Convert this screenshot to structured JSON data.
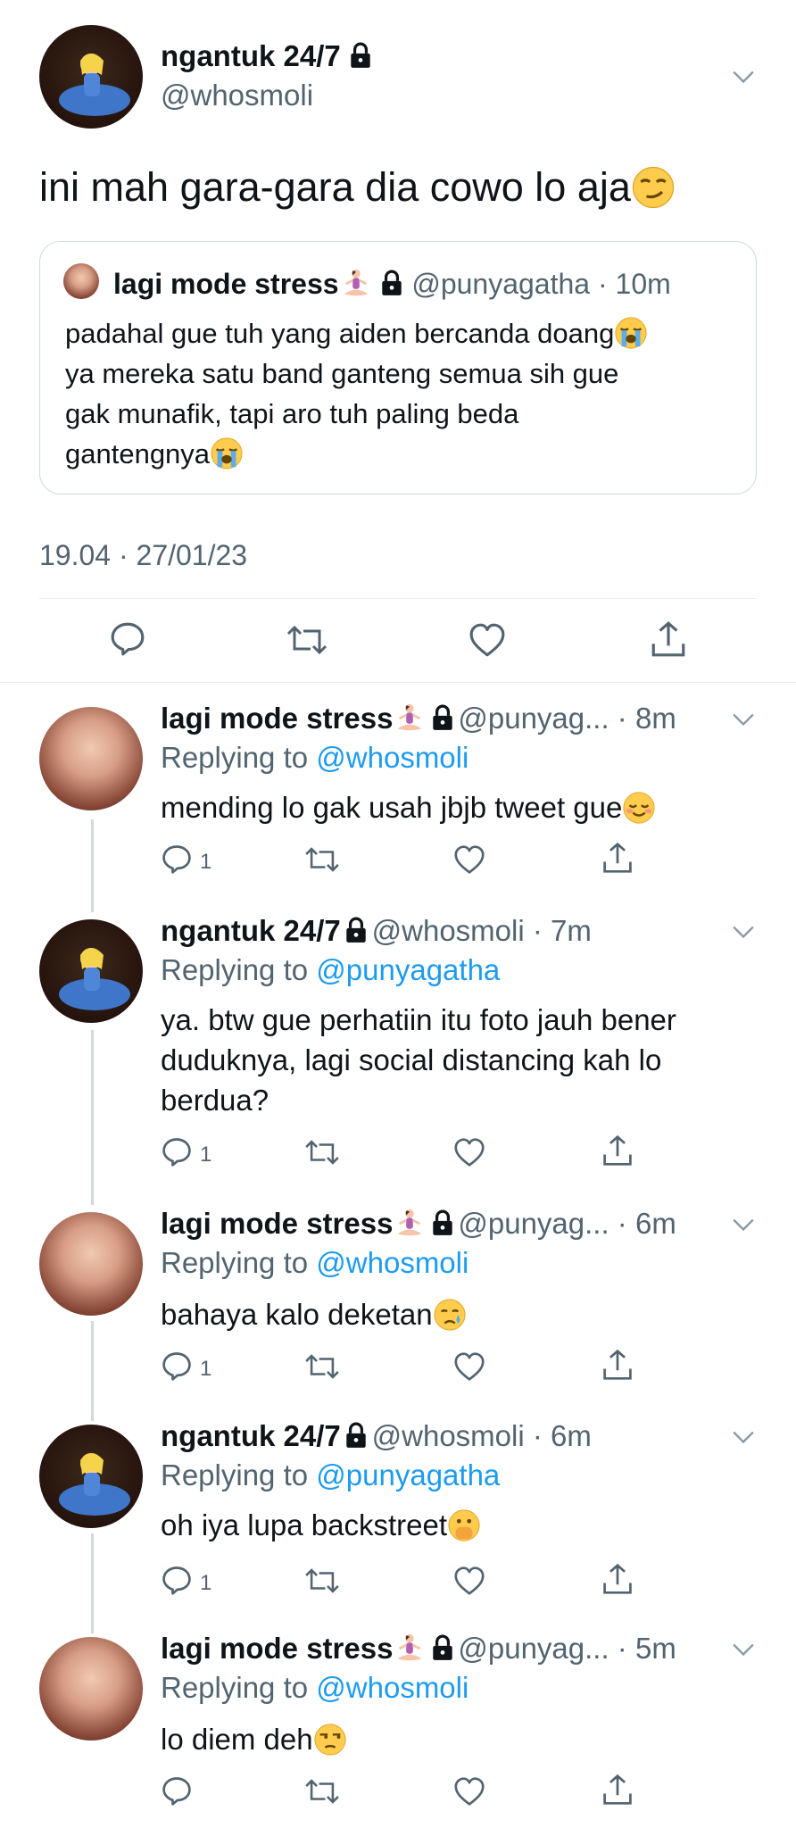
{
  "main_tweet": {
    "name": "ngantuk 24/7",
    "handle": "@whosmoli",
    "text": "ini mah gara-gara dia cowo lo aja",
    "timestamp": "19.04 · 27/01/23"
  },
  "quoted_tweet": {
    "name": "lagi mode stress",
    "handle": "@punyagatha",
    "time": "10m",
    "line1": "padahal gue tuh yang aiden bercanda doang",
    "line2": "ya mereka satu band ganteng semua sih gue",
    "line3": "gak munafik, tapi aro tuh paling beda",
    "line4": "gantengnya"
  },
  "replying_prefix": "Replying to",
  "replies": [
    {
      "name": "lagi mode stress",
      "handle": "@punyag...",
      "time": "8m",
      "reply_to": "@whosmoli",
      "line1": "mending lo gak usah jbjb tweet gue",
      "reply_count": "1"
    },
    {
      "name": "ngantuk 24/7",
      "handle": "@whosmoli",
      "time": "7m",
      "reply_to": "@punyagatha",
      "line1": "ya. btw gue perhatiin itu foto jauh bener",
      "line2": "duduknya, lagi social distancing kah lo",
      "line3": "berdua?",
      "reply_count": "1"
    },
    {
      "name": "lagi mode stress",
      "handle": "@punyag...",
      "time": "6m",
      "reply_to": "@whosmoli",
      "line1": "bahaya kalo deketan",
      "reply_count": "1"
    },
    {
      "name": "ngantuk 24/7",
      "handle": "@whosmoli",
      "time": "6m",
      "reply_to": "@punyagatha",
      "line1": "oh iya lupa backstreet",
      "reply_count": "1"
    },
    {
      "name": "lagi mode stress",
      "handle": "@punyag...",
      "time": "5m",
      "reply_to": "@whosmoli",
      "line1": "lo diem deh",
      "reply_count": ""
    }
  ],
  "icons": [
    "lock-icon",
    "chevron-down-icon",
    "reply-icon",
    "retweet-icon",
    "like-icon",
    "share-icon",
    "smirk-emoji",
    "sob-emoji",
    "lotus-emoji",
    "relieved-emoji",
    "sad-tear-emoji",
    "hand-over-mouth-emoji",
    "unamused-emoji"
  ],
  "colors": {
    "text": "#0f1419",
    "muted": "#536471",
    "link": "#1d9bf0",
    "line": "#cfd9de",
    "divider": "#e6ecf0"
  }
}
